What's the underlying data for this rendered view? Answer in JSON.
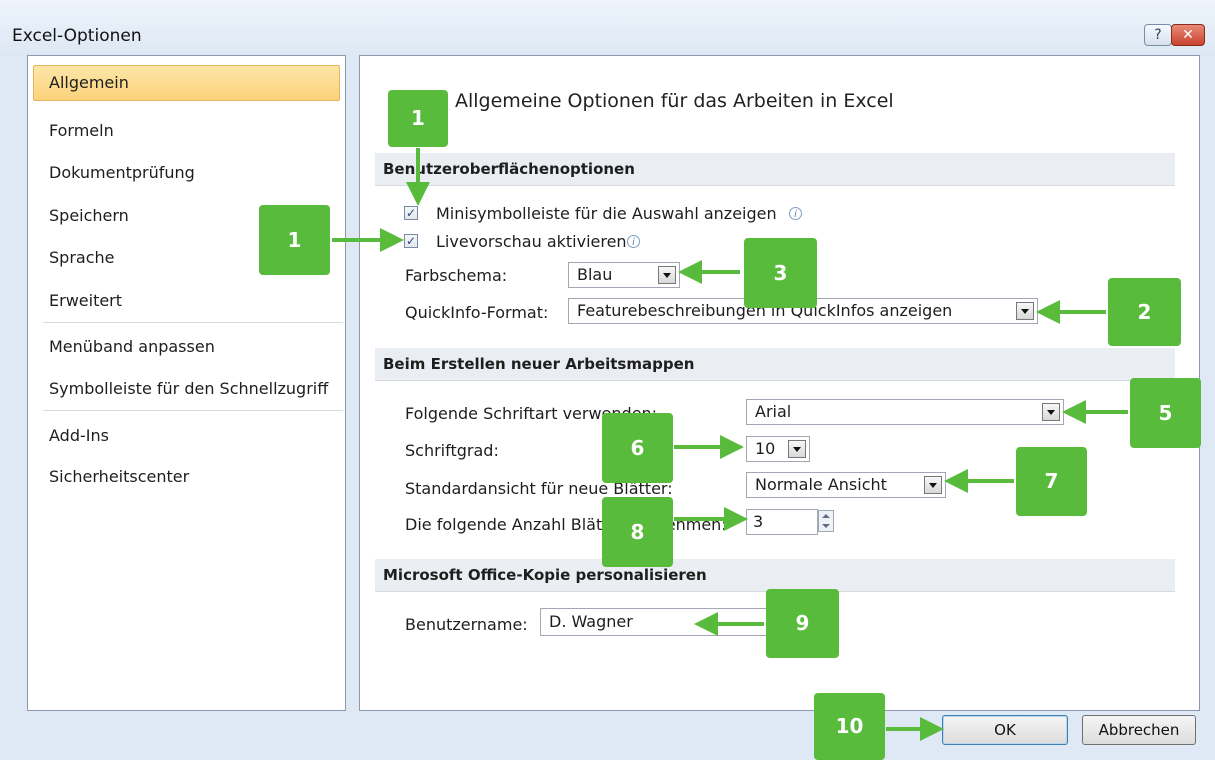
{
  "window": {
    "title": "Excel-Optionen",
    "help_label": "?",
    "close_label": "✕"
  },
  "nav": {
    "items": [
      {
        "label": "Allgemein",
        "selected": true
      },
      {
        "label": "Formeln"
      },
      {
        "label": "Dokumentprüfung"
      },
      {
        "label": "Speichern"
      },
      {
        "label": "Sprache"
      },
      {
        "label": "Erweitert"
      },
      {
        "label": "Menüband anpassen"
      },
      {
        "label": "Symbolleiste für den Schnellzugriff"
      },
      {
        "label": "Add-Ins"
      },
      {
        "label": "Sicherheitscenter"
      }
    ]
  },
  "content": {
    "heading": "Allgemeine Optionen für das Arbeiten in Excel",
    "sections": {
      "ui": "Benutzeroberflächenoptionen",
      "new_workbooks": "Beim Erstellen neuer Arbeitsmappen",
      "personalize": "Microsoft Office-Kopie personalisieren"
    },
    "ui_options": {
      "mini_toolbar": {
        "label": "Minisymbolleiste für die Auswahl anzeigen",
        "checked": true
      },
      "live_preview": {
        "label": "Livevorschau aktivieren",
        "checked": true
      },
      "color_scheme_label": "Farbschema:",
      "color_scheme_value": "Blau",
      "screentip_label": "QuickInfo-Format:",
      "screentip_value": "Featurebeschreibungen in QuickInfos anzeigen"
    },
    "new_workbook_options": {
      "font_label": "Folgende Schriftart verwenden:",
      "font_value": "Arial",
      "font_size_label": "Schriftgrad:",
      "font_size_value": "10",
      "default_view_label": "Standardansicht für neue Blätter:",
      "default_view_value": "Normale Ansicht",
      "sheet_count_label": "Die folgende Anzahl Blätter aufnehmen:",
      "sheet_count_value": "3"
    },
    "personalize_options": {
      "username_label": "Benutzername:",
      "username_value": "D. Wagner"
    }
  },
  "footer": {
    "ok_label": "OK",
    "cancel_label": "Abbrechen"
  },
  "annotations": {
    "badge_color": "#58bb3c",
    "badges": [
      "1",
      "1",
      "2",
      "3",
      "5",
      "6",
      "7",
      "8",
      "9",
      "10"
    ]
  }
}
